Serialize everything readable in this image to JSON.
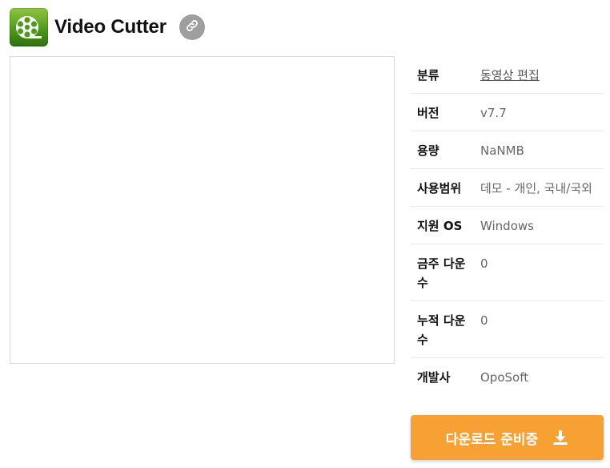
{
  "app": {
    "title": "Video Cutter",
    "icon": "film-reel-icon",
    "link_icon": "link-icon",
    "colors": {
      "icon_green": "#4f9a1d",
      "link_button": "#9e9e9e",
      "download_button": "#f7a034"
    }
  },
  "info": {
    "rows": [
      {
        "label": "분류",
        "value": "동영상 편집"
      },
      {
        "label": "버전",
        "value": "v7.7"
      },
      {
        "label": "용량",
        "value": "NaNMB"
      },
      {
        "label": "사용범위",
        "value": "데모 - 개인, 국내/국외"
      },
      {
        "label": "지원 OS",
        "value": "Windows"
      },
      {
        "label": "금주 다운수",
        "value": "0"
      },
      {
        "label": "누적 다운수",
        "value": "0"
      },
      {
        "label": "개발사",
        "value": "OpoSoft"
      }
    ]
  },
  "download": {
    "label": "다운로드 준비중",
    "icon": "download-icon"
  }
}
